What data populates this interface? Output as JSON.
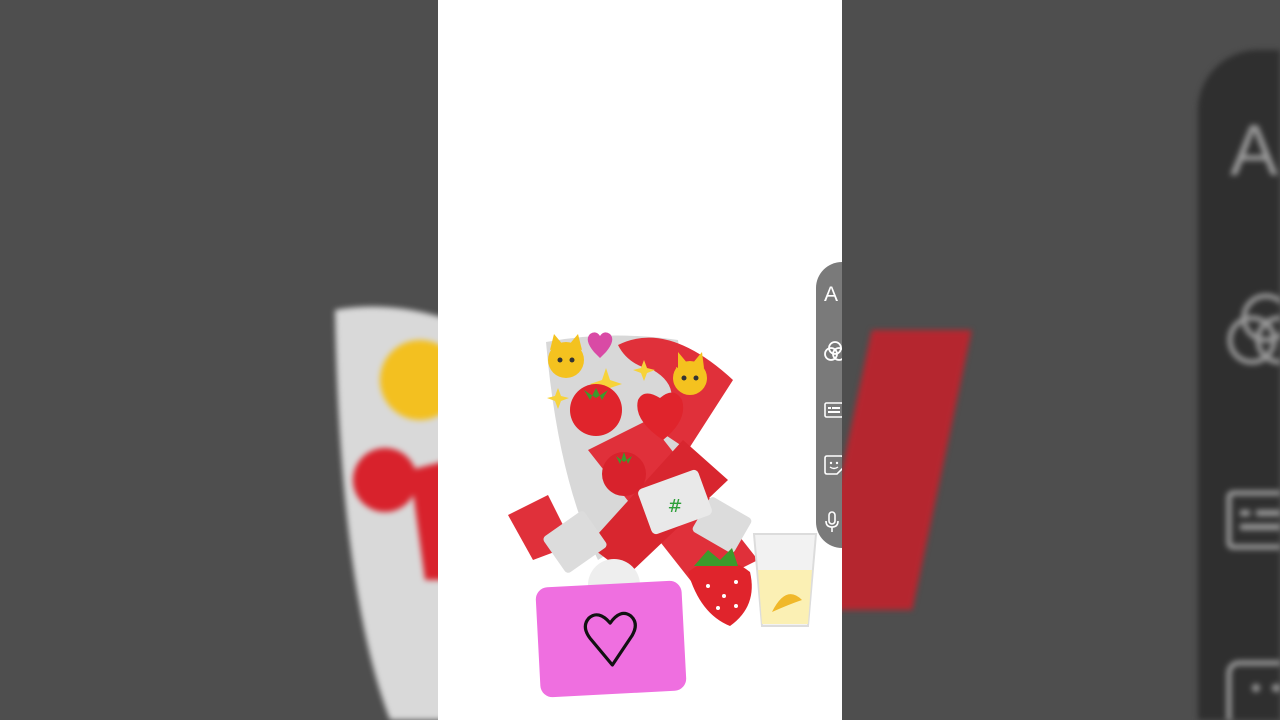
{
  "toolbar": {
    "items": [
      {
        "name": "text-tool",
        "label": "A",
        "icon": "text-icon"
      },
      {
        "name": "effects-tool",
        "icon": "effects-circles-icon"
      },
      {
        "name": "captions-tool",
        "icon": "captions-icon"
      },
      {
        "name": "sticker-tool",
        "icon": "sticker-icon"
      },
      {
        "name": "voiceover-tool",
        "icon": "microphone-icon"
      }
    ]
  },
  "backdrop": {
    "text_tool_label": "A"
  },
  "reaction": {
    "icon": "heart-outline-icon"
  },
  "colors": {
    "toolbar_bg": "#7a7a7a",
    "heart_button": "#ef6fe0",
    "ribbon_red": "#e0303a",
    "frame_bg": "#ffffff",
    "side_bg": "#4e4e4e"
  }
}
